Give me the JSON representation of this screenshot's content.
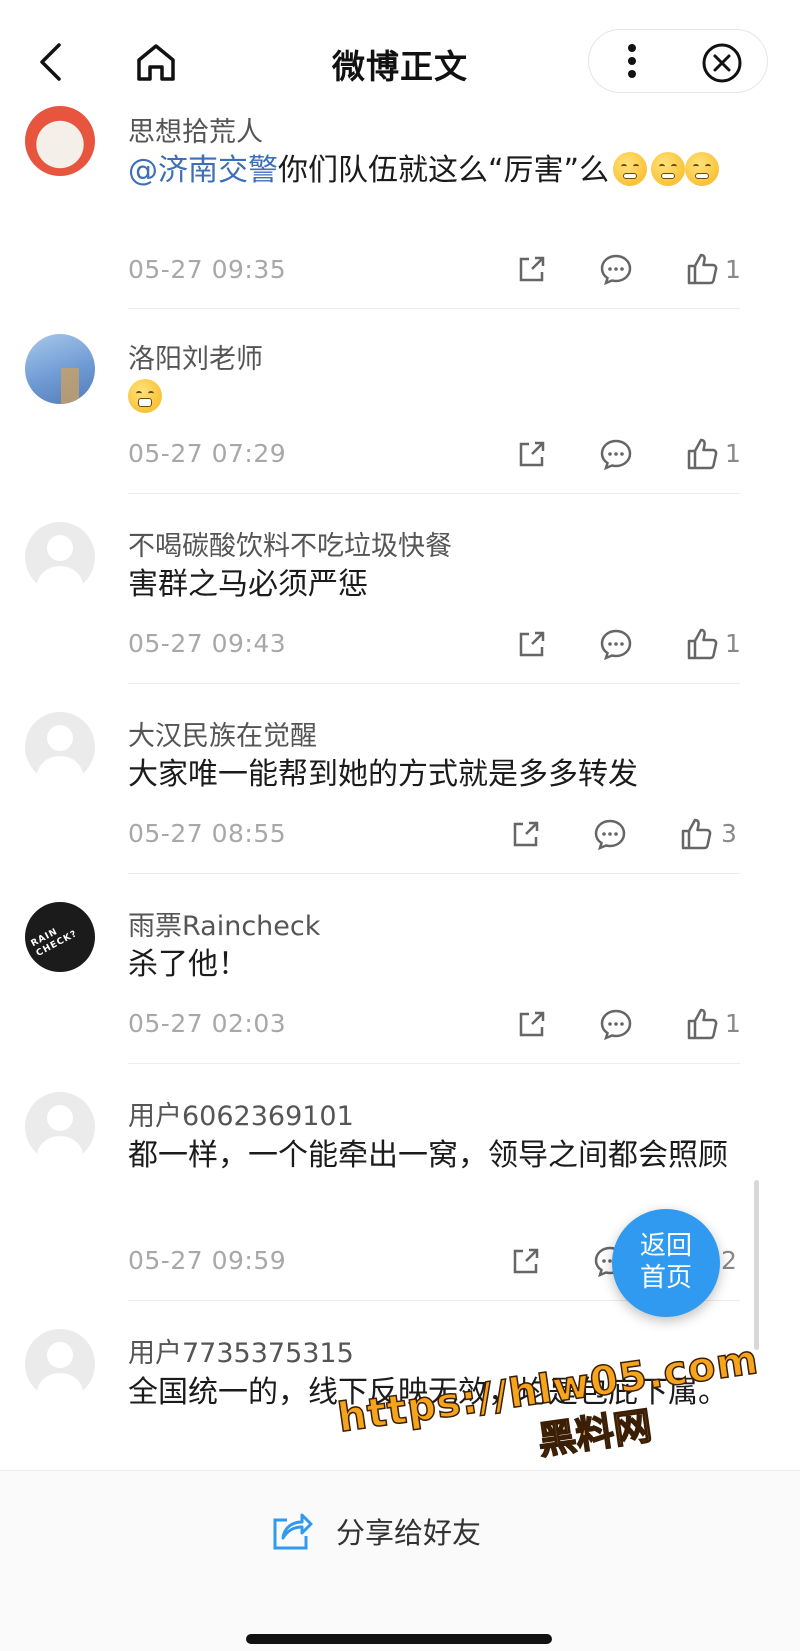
{
  "header": {
    "title": "微博正文",
    "back_icon": "chevron-left-icon",
    "home_icon": "home-icon",
    "more_icon": "more-vertical-icon",
    "close_icon": "close-circle-icon"
  },
  "comments": [
    {
      "username": "思想拾荒人",
      "mention": "@济南交警",
      "text": "你们队伍就这么“厉害”么",
      "emojis": [
        "shush-emoji",
        "shush-emoji",
        "shush-emoji"
      ],
      "time": "05-27 09:35",
      "likes": "1"
    },
    {
      "username": "洛阳刘老师",
      "text": "",
      "emojis": [
        "grin-emoji"
      ],
      "time": "05-27 07:29",
      "likes": "1"
    },
    {
      "username": "不喝碳酸饮料不吃垃圾快餐",
      "text": "害群之马必须严惩",
      "time": "05-27 09:43",
      "likes": "1"
    },
    {
      "username": "大汉民族在觉醒",
      "text": "大家唯一能帮到她的方式就是多多转发",
      "time": "05-27 08:55",
      "likes": "3"
    },
    {
      "username": "雨票Raincheck",
      "avatar_text": "RAIN CHECK?",
      "text": "杀了他！",
      "time": "05-27 02:03",
      "likes": "1"
    },
    {
      "username": "用户6062369101",
      "text": "都一样，一个能牵出一窝，领导之间都会照顾",
      "time": "05-27 09:59",
      "likes": "2"
    },
    {
      "username": "用户7735375315",
      "text": "全国统一的，线下反映无效，均是包庇下属。"
    }
  ],
  "float_button": {
    "line1": "返回",
    "line2": "首页"
  },
  "bottom_bar": {
    "share_label": "分享给好友",
    "share_icon": "share-icon"
  },
  "watermark": {
    "url": "https://hlw05.com",
    "name": "黑料网"
  },
  "colors": {
    "accent": "#2f9af0",
    "mention": "#3d6fb6",
    "watermark": "#f5a41b"
  }
}
